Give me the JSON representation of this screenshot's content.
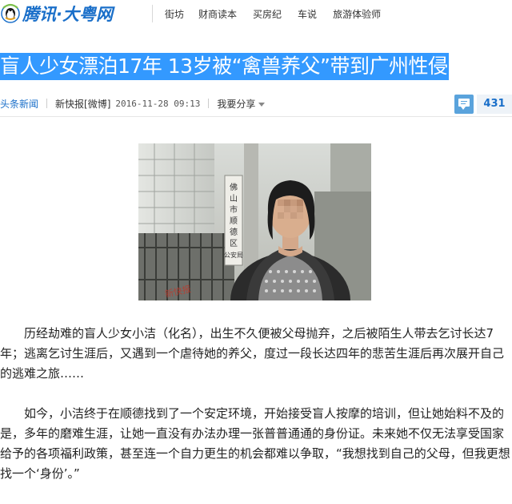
{
  "site": {
    "logo_text": "腾讯·大粤网",
    "logo_icon": "tencent-qq-icon"
  },
  "nav": {
    "items": [
      {
        "label": "街坊"
      },
      {
        "label": "财商读本"
      },
      {
        "label": "买房纪"
      },
      {
        "label": "车说"
      },
      {
        "label": "旅游体验师"
      }
    ]
  },
  "article": {
    "headline": "盲人少女漂泊17年 13岁被“禽兽养父”带到广州性侵",
    "source_tag": "头条新闻",
    "publisher": "新快报",
    "weibo": "[微博]",
    "timestamp": "2016-11-28 09:13",
    "share_label": "我要分享",
    "comment_icon": "comment-icon",
    "comment_count": "431",
    "photo": {
      "sign_text": "佛山市顺德区公安局",
      "watermark": "新快报"
    },
    "paragraphs": [
      "历经劫难的盲人少女小洁（化名），出生不久便被父母抛弃，之后被陌生人带去乞讨长达7年；逃离乞讨生涯后，又遇到一个虐待她的养父，度过一段长达四年的悲苦生涯后再次展开自己的逃难之旅……",
      "如今，小洁终于在顺德找到了一个安定环境，开始接受盲人按摩的培训，但让她始料不及的是，多年的磨难生涯，让她一直没有办法办理一张普普通通的身份证。未来她不仅无法享受国家给予的各项福利政策，甚至连一个自力更生的机会都难以争取，“我想找到自己的父母，但我更想找一个‘身份’。”"
    ]
  },
  "colors": {
    "brand_blue": "#1a6fc9",
    "headline_highlight": "#3399ff",
    "comment_blue": "#5aa3dc"
  }
}
